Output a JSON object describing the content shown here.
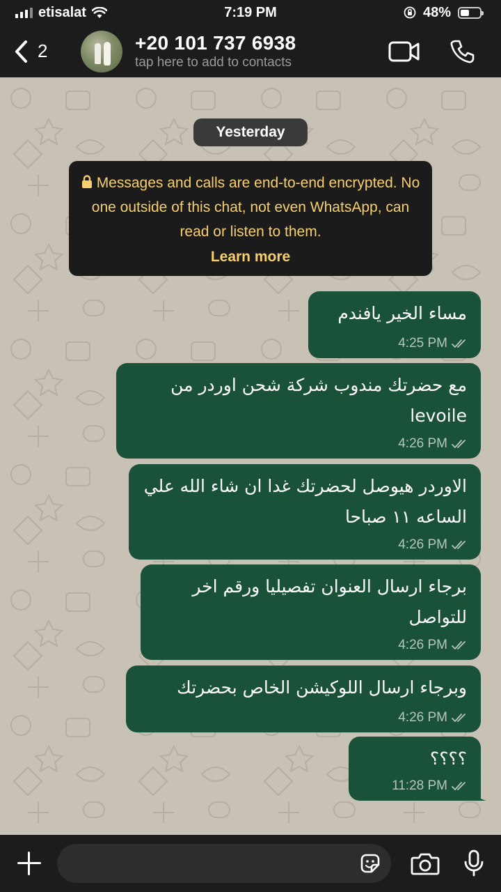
{
  "status_bar": {
    "carrier": "etisalat",
    "time": "7:19 PM",
    "battery": "48%",
    "battery_level": 0.48
  },
  "header": {
    "back_count": "2",
    "contact_name": "+20 101 737 6938",
    "contact_sub": "tap here to add to contacts"
  },
  "chat": {
    "date_label": "Yesterday",
    "encryption_notice": "Messages and calls are end-to-end encrypted. No one outside of this chat, not even WhatsApp, can read or listen to them.",
    "learn_more": "Learn more",
    "messages": [
      {
        "text": "مساء الخير يافندم",
        "time": "4:25 PM"
      },
      {
        "text": "مع حضرتك مندوب شركة شحن اوردر من levoile",
        "time": "4:26 PM"
      },
      {
        "text": "الاوردر هيوصل لحضرتك غدا ان شاء الله علي الساعه ١١ صباحا",
        "time": "4:26 PM"
      },
      {
        "text": "برجاء ارسال العنوان تفصيليا ورقم اخر للتواصل",
        "time": "4:26 PM"
      },
      {
        "text": "وبرجاء ارسال اللوكيشن الخاص بحضرتك",
        "time": "4:26 PM"
      },
      {
        "text": "؟؟؟؟",
        "time": "11:28 PM"
      }
    ]
  },
  "input": {
    "placeholder": ""
  },
  "icons": {
    "back": "chevron-left-icon",
    "video": "video-call-icon",
    "phone": "phone-icon",
    "lock": "lock-icon",
    "read": "double-check-icon",
    "add": "plus-icon",
    "sticker": "sticker-icon",
    "camera": "camera-icon",
    "mic": "microphone-icon"
  },
  "colors": {
    "bar_background": "#1c1c1c",
    "chat_background": "#c7c1b6",
    "outgoing_bubble": "#1a5239",
    "notice_text": "#f7cf6e",
    "notice_background": "#1b1b1b"
  }
}
